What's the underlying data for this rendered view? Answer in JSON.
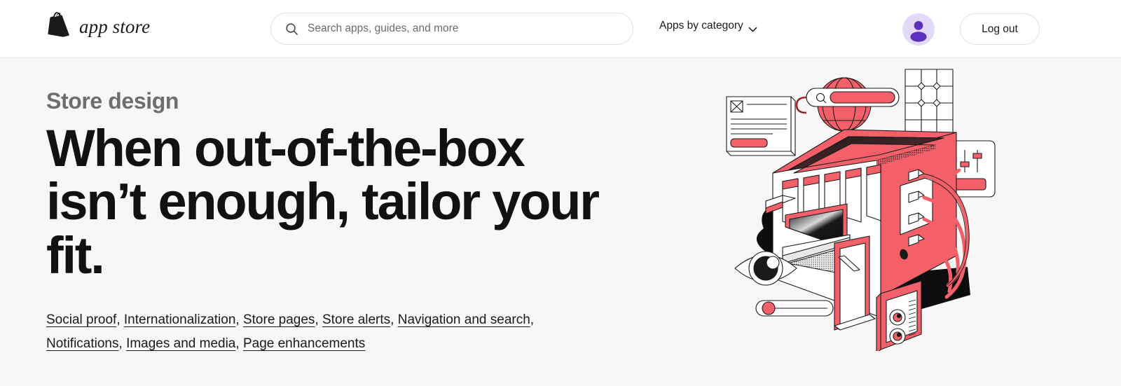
{
  "header": {
    "brand": {
      "name": "app store",
      "logo_icon": "shopify-bag-icon"
    },
    "search": {
      "icon": "search-icon",
      "placeholder": "Search apps, guides, and more",
      "value": ""
    },
    "category_menu": {
      "label": "Apps by category",
      "icon": "chevron-down-icon"
    },
    "avatar": {
      "icon": "user-avatar-icon",
      "bg_color": "#e3daf8",
      "fg_color": "#5c2fbd"
    },
    "logout": {
      "label": "Log out"
    }
  },
  "hero": {
    "eyebrow": "Store design",
    "headline": "When out-of-the-box isn’t enough, tailor your fit.",
    "bg_color": "#f7f7f7",
    "links": [
      {
        "label": "Social proof"
      },
      {
        "label": "Internationalization"
      },
      {
        "label": "Store pages"
      },
      {
        "label": "Store alerts"
      },
      {
        "label": "Navigation and search"
      },
      {
        "label": "Notifications"
      },
      {
        "label": "Images and media"
      },
      {
        "label": "Page enhancements"
      }
    ],
    "link_separator": ",",
    "illustration": {
      "name": "isometric-storefront-illustration",
      "accent_color": "#f4606a",
      "line_color": "#1a1a1a",
      "elements": [
        "storefront-building",
        "globe-with-search-bar",
        "grid-panel",
        "slider-control-panel",
        "document-card",
        "eye-icon",
        "progress-slider",
        "cable-connectors",
        "dial-panel"
      ]
    }
  }
}
